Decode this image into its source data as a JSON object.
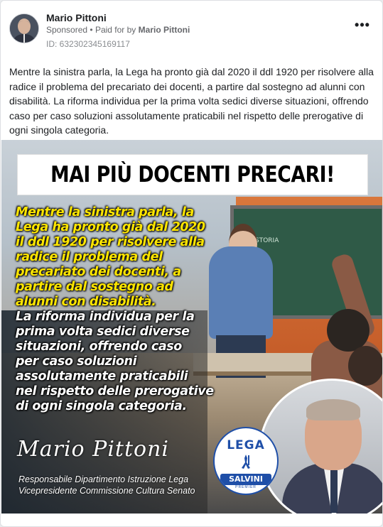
{
  "post": {
    "author": "Mario Pittoni",
    "sponsored_label": "Sponsored",
    "separator": "•",
    "paid_for_by_label": "Paid for by",
    "paid_for_by_name": "Mario Pittoni",
    "ad_id": "ID: 632302345169117",
    "more_icon": "more-horizontal-icon",
    "body": "Mentre la sinistra parla, la Lega ha pronto già dal 2020 il ddl 1920 per risolvere alla radice il problema del precariato dei docenti, a partire dal sostegno ad alunni con disabilità. La riforma individua per la prima volta sedici diverse situazioni, offrendo caso per caso soluzioni assolutamente praticabili nel rispetto delle prerogative di ogni singola categoria."
  },
  "creative": {
    "headline": "MAI PIÙ DOCENTI PRECARI!",
    "board_text": "STORIA",
    "yellow_lines": [
      "Mentre la sinistra parla, la",
      "Lega ha pronto già dal 2020",
      "il ddl 1920 per risolvere alla",
      "radice il problema del",
      "precariato dei docenti, a",
      "partire dal sostegno ad",
      "alunni con disabilità."
    ],
    "white_lines": [
      "La riforma individua per la",
      "prima volta sedici diverse",
      "situazioni, offrendo caso",
      "per caso soluzioni",
      "assolutamente praticabili",
      "nel rispetto delle prerogative",
      "di ogni singola categoria."
    ],
    "signature": "Mario Pittoni",
    "role_line_1": "Responsabile Dipartimento Istruzione Lega",
    "role_line_2": "Vicepresidente Commissione Cultura Senato",
    "logo": {
      "top": "LEGA",
      "bottom": "SALVINI",
      "sub": "PREMIER"
    },
    "colors": {
      "highlight": "#ffe600",
      "lega_blue": "#1f4fa8"
    }
  }
}
